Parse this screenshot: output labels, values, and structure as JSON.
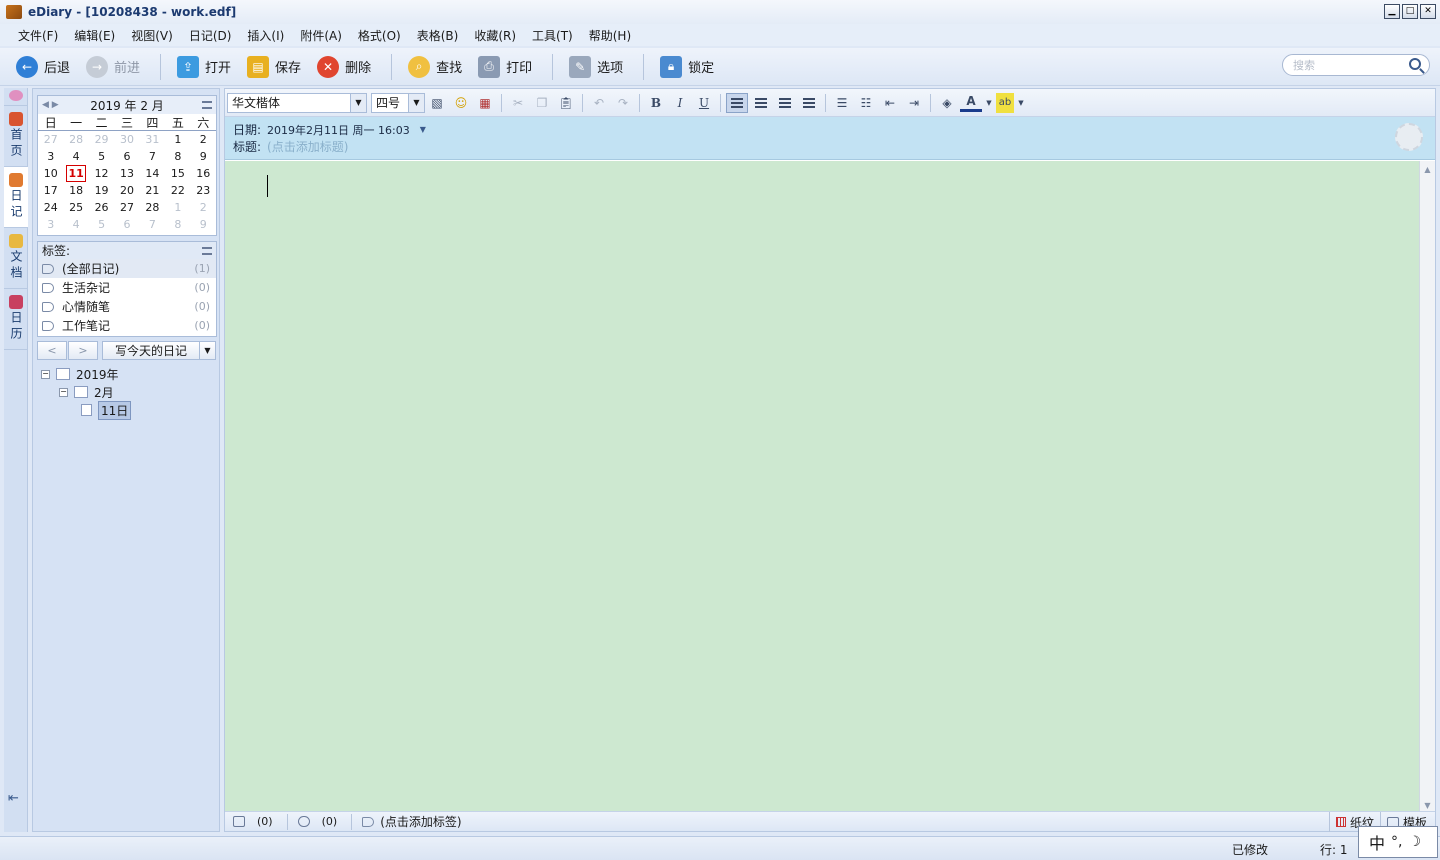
{
  "window": {
    "title": "eDiary - [10208438 - work.edf]",
    "controls": [
      "minimize",
      "maximize",
      "close"
    ]
  },
  "menu": [
    "文件(F)",
    "编辑(E)",
    "视图(V)",
    "日记(D)",
    "插入(I)",
    "附件(A)",
    "格式(O)",
    "表格(B)",
    "收藏(R)",
    "工具(T)",
    "帮助(H)"
  ],
  "toolbar": {
    "back": "后退",
    "forward": "前进",
    "open": "打开",
    "save": "保存",
    "delete": "删除",
    "find": "查找",
    "print": "打印",
    "options": "选项",
    "lock": "锁定",
    "search_placeholder": "搜索"
  },
  "vtabs": [
    {
      "label": "首页",
      "icon": "home-icon"
    },
    {
      "label": "日记",
      "icon": "diary-icon"
    },
    {
      "label": "文档",
      "icon": "document-icon"
    },
    {
      "label": "日历",
      "icon": "calendar-icon"
    }
  ],
  "calendar": {
    "header": "2019 年 2 月",
    "weekdays": [
      "日",
      "一",
      "二",
      "三",
      "四",
      "五",
      "六"
    ],
    "days": [
      [
        "27",
        "28",
        "29",
        "30",
        "31",
        "1",
        "2"
      ],
      [
        "3",
        "4",
        "5",
        "6",
        "7",
        "8",
        "9"
      ],
      [
        "10",
        "11",
        "12",
        "13",
        "14",
        "15",
        "16"
      ],
      [
        "17",
        "18",
        "19",
        "20",
        "21",
        "22",
        "23"
      ],
      [
        "24",
        "25",
        "26",
        "27",
        "28",
        "1",
        "2"
      ],
      [
        "3",
        "4",
        "5",
        "6",
        "7",
        "8",
        "9"
      ]
    ],
    "today": "11"
  },
  "tags": {
    "header": "标签:",
    "items": [
      {
        "label": "(全部日记)",
        "count": "(1)"
      },
      {
        "label": "生活杂记",
        "count": "(0)"
      },
      {
        "label": "心情随笔",
        "count": "(0)"
      },
      {
        "label": "工作笔记",
        "count": "(0)"
      }
    ]
  },
  "nav": {
    "prev": "<",
    "next": ">",
    "write_today": "写今天的日记"
  },
  "tree": {
    "year": "2019年",
    "month": "2月",
    "day": "11日"
  },
  "format": {
    "font": "华文楷体",
    "size": "四号"
  },
  "entry": {
    "date_label": "日期:",
    "date_value": "2019年2月11日  周一  16:03",
    "title_label": "标题:",
    "title_placeholder": "(点击添加标题)"
  },
  "footer": {
    "attachments": "(0)",
    "comments": "(0)",
    "tags_placeholder": "(点击添加标签)",
    "paper": "纸纹",
    "template": "模板"
  },
  "status": {
    "modified": "已修改",
    "line": "行:  1"
  },
  "ime": {
    "mode": "中",
    "punct": "°,",
    "moon": "☽"
  },
  "colors": {
    "content_bg": "#cde8d0",
    "header_bg": "#c2e2f3",
    "today": "#d40000"
  }
}
